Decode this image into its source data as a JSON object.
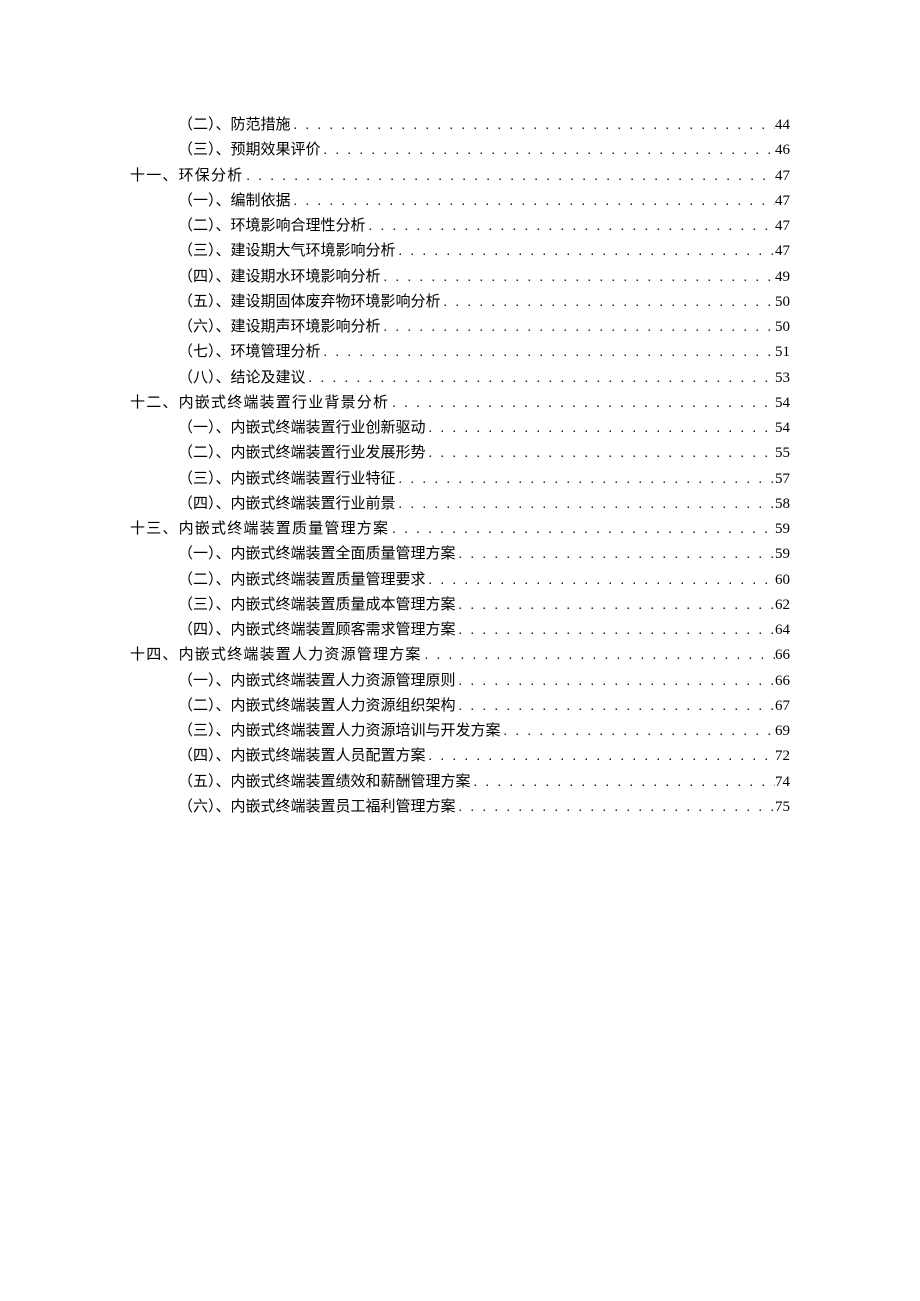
{
  "toc": [
    {
      "level": 2,
      "title": "（二）、防范措施",
      "page": "44"
    },
    {
      "level": 2,
      "title": "（三）、预期效果评价",
      "page": "46"
    },
    {
      "level": 1,
      "title": "十一、环保分析",
      "page": "47",
      "spaced": true
    },
    {
      "level": 2,
      "title": "（一）、编制依据",
      "page": "47"
    },
    {
      "level": 2,
      "title": "（二）、环境影响合理性分析",
      "page": "47"
    },
    {
      "level": 2,
      "title": "（三）、建设期大气环境影响分析",
      "page": "47"
    },
    {
      "level": 2,
      "title": "（四）、建设期水环境影响分析",
      "page": "49"
    },
    {
      "level": 2,
      "title": "（五）、建设期固体废弃物环境影响分析",
      "page": "50"
    },
    {
      "level": 2,
      "title": "（六）、建设期声环境影响分析",
      "page": "50"
    },
    {
      "level": 2,
      "title": "（七）、环境管理分析",
      "page": "51"
    },
    {
      "level": 2,
      "title": "（八）、结论及建议",
      "page": "53"
    },
    {
      "level": 1,
      "title": "十二、内嵌式终端装置行业背景分析",
      "page": "54",
      "spaced": true
    },
    {
      "level": 2,
      "title": "（一）、内嵌式终端装置行业创新驱动",
      "page": "54"
    },
    {
      "level": 2,
      "title": "（二）、内嵌式终端装置行业发展形势",
      "page": "55"
    },
    {
      "level": 2,
      "title": "（三）、内嵌式终端装置行业特征",
      "page": "57"
    },
    {
      "level": 2,
      "title": "（四）、内嵌式终端装置行业前景",
      "page": "58"
    },
    {
      "level": 1,
      "title": "十三、内嵌式终端装置质量管理方案",
      "page": "59",
      "spaced": true
    },
    {
      "level": 2,
      "title": "（一）、内嵌式终端装置全面质量管理方案",
      "page": "59"
    },
    {
      "level": 2,
      "title": "（二）、内嵌式终端装置质量管理要求",
      "page": "60"
    },
    {
      "level": 2,
      "title": "（三）、内嵌式终端装置质量成本管理方案",
      "page": "62"
    },
    {
      "level": 2,
      "title": "（四）、内嵌式终端装置顾客需求管理方案",
      "page": "64"
    },
    {
      "level": 1,
      "title": "十四、内嵌式终端装置人力资源管理方案",
      "page": "66",
      "spaced": true
    },
    {
      "level": 2,
      "title": "（一）、内嵌式终端装置人力资源管理原则",
      "page": "66"
    },
    {
      "level": 2,
      "title": "（二）、内嵌式终端装置人力资源组织架构",
      "page": "67"
    },
    {
      "level": 2,
      "title": "（三）、内嵌式终端装置人力资源培训与开发方案",
      "page": "69"
    },
    {
      "level": 2,
      "title": "（四）、内嵌式终端装置人员配置方案",
      "page": "72"
    },
    {
      "level": 2,
      "title": "（五）、内嵌式终端装置绩效和薪酬管理方案",
      "page": "74"
    },
    {
      "level": 2,
      "title": "（六）、内嵌式终端装置员工福利管理方案",
      "page": "75"
    }
  ]
}
